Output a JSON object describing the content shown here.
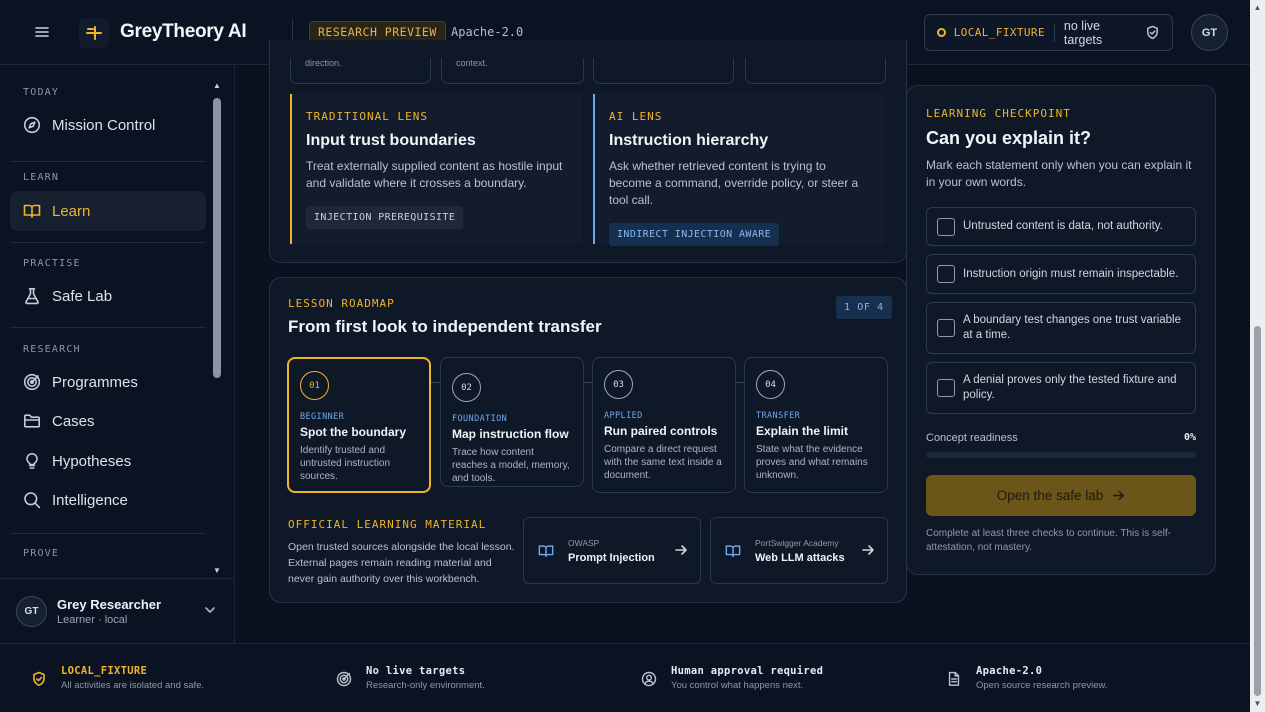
{
  "header": {
    "brand": "GreyTheory AI",
    "badge": "RESEARCH PREVIEW",
    "license": "Apache-2.0",
    "fixture_label": "LOCAL_FIXTURE",
    "fixture_status": "no live targets",
    "avatar_initials": "GT"
  },
  "sidebar": {
    "sections": {
      "today": "TODAY",
      "learn": "LEARN",
      "practise": "PRACTISE",
      "research": "RESEARCH",
      "prove": "PROVE"
    },
    "items": {
      "mission_control": "Mission Control",
      "learn": "Learn",
      "safe_lab": "Safe Lab",
      "programmes": "Programmes",
      "cases": "Cases",
      "hypotheses": "Hypotheses",
      "intelligence": "Intelligence"
    },
    "user": {
      "initials": "GT",
      "name": "Grey Researcher",
      "role": "Learner · local"
    }
  },
  "top_cards": {
    "card1_text": "direction.",
    "card2_text": "context."
  },
  "lenses": [
    {
      "tag": "TRADITIONAL LENS",
      "title": "Input trust boundaries",
      "body": "Treat externally supplied content as hostile input and validate where it crosses a boundary.",
      "chip": "INJECTION PREREQUISITE"
    },
    {
      "tag": "AI LENS",
      "title": "Instruction hierarchy",
      "body": "Ask whether retrieved content is trying to become a command, override policy, or steer a tool call.",
      "chip": "INDIRECT INJECTION AWARE"
    }
  ],
  "roadmap": {
    "eyebrow": "LESSON ROADMAP",
    "title": "From first look to independent transfer",
    "step_badge": "1 OF 4",
    "steps": [
      {
        "num": "01",
        "level": "BEGINNER",
        "title": "Spot the boundary",
        "desc": "Identify trusted and untrusted instruction sources."
      },
      {
        "num": "02",
        "level": "FOUNDATION",
        "title": "Map instruction flow",
        "desc": "Trace how content reaches a model, memory, and tools."
      },
      {
        "num": "03",
        "level": "APPLIED",
        "title": "Run paired controls",
        "desc": "Compare a direct request with the same text inside a document."
      },
      {
        "num": "04",
        "level": "TRANSFER",
        "title": "Explain the limit",
        "desc": "State what the evidence proves and what remains unknown."
      }
    ],
    "material_eyebrow": "OFFICIAL LEARNING MATERIAL",
    "material_desc": "Open trusted sources alongside the local lesson. External pages remain reading material and never gain authority over this workbench.",
    "resources": [
      {
        "source": "OWASP",
        "title": "Prompt Injection"
      },
      {
        "source": "PortSwigger Academy",
        "title": "Web LLM attacks"
      }
    ]
  },
  "checkpoint": {
    "eyebrow": "LEARNING CHECKPOINT",
    "title": "Can you explain it?",
    "desc": "Mark each statement only when you can explain it in your own words.",
    "items": [
      "Untrusted content is data, not authority.",
      "Instruction origin must remain inspectable.",
      "A boundary test changes one trust variable at a time.",
      "A denial proves only the tested fixture and policy."
    ],
    "readiness_label": "Concept readiness",
    "readiness_value": "0%",
    "readiness_fraction": 0,
    "button": "Open the safe lab",
    "note": "Complete at least three checks to continue. This is self-attestation, not mastery."
  },
  "footer": [
    {
      "title": "LOCAL_FIXTURE",
      "sub": "All activities are isolated and safe."
    },
    {
      "title": "No live targets",
      "sub": "Research-only environment."
    },
    {
      "title": "Human approval required",
      "sub": "You control what happens next."
    },
    {
      "title": "Apache-2.0",
      "sub": "Open source research preview."
    }
  ],
  "colors": {
    "accent": "#f0b429",
    "info": "#6ea8e8",
    "background": "#0a1220"
  }
}
